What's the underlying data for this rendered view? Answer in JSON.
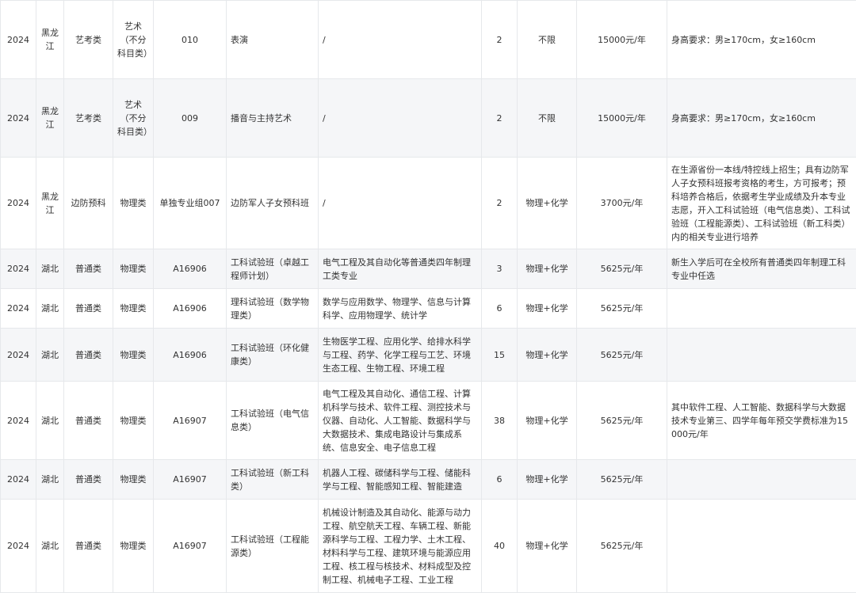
{
  "rows": [
    {
      "year": "2024",
      "province": "黑龙江",
      "type": "艺考类",
      "subject": "艺术（不分科目类）",
      "code": "010",
      "major": "表演",
      "includes": "/",
      "count": "2",
      "req": "不限",
      "fee": "15000元/年",
      "note": "身高要求：男≥170cm，女≥160cm"
    },
    {
      "year": "2024",
      "province": "黑龙江",
      "type": "艺考类",
      "subject": "艺术（不分科目类）",
      "code": "009",
      "major": "播音与主持艺术",
      "includes": "/",
      "count": "2",
      "req": "不限",
      "fee": "15000元/年",
      "note": "身高要求：男≥170cm，女≥160cm"
    },
    {
      "year": "2024",
      "province": "黑龙江",
      "type": "边防预科",
      "subject": "物理类",
      "code": "单独专业组007",
      "major": "边防军人子女预科班",
      "includes": "/",
      "count": "2",
      "req": "物理+化学",
      "fee": "3700元/年",
      "note": "在生源省份一本线/特控线上招生；具有边防军人子女预科班报考资格的考生，方可报考；预科培养合格后，依据考生学业成绩及升本专业志愿，开入工科试验班（电气信息类）、工科试验班（工程能源类）、工科试验班（新工科类）内的相关专业进行培养"
    },
    {
      "year": "2024",
      "province": "湖北",
      "type": "普通类",
      "subject": "物理类",
      "code": "A16906",
      "major": "工科试验班（卓越工程师计划）",
      "includes": "电气工程及其自动化等普通类四年制理工类专业",
      "count": "3",
      "req": "物理+化学",
      "fee": "5625元/年",
      "note": "新生入学后可在全校所有普通类四年制理工科专业中任选"
    },
    {
      "year": "2024",
      "province": "湖北",
      "type": "普通类",
      "subject": "物理类",
      "code": "A16906",
      "major": "理科试验班（数学物理类）",
      "includes": "数学与应用数学、物理学、信息与计算科学、应用物理学、统计学",
      "count": "6",
      "req": "物理+化学",
      "fee": "5625元/年",
      "note": ""
    },
    {
      "year": "2024",
      "province": "湖北",
      "type": "普通类",
      "subject": "物理类",
      "code": "A16906",
      "major": "工科试验班（环化健康类）",
      "includes": "生物医学工程、应用化学、给排水科学与工程、药学、化学工程与工艺、环境生态工程、生物工程、环境工程",
      "count": "15",
      "req": "物理+化学",
      "fee": "5625元/年",
      "note": ""
    },
    {
      "year": "2024",
      "province": "湖北",
      "type": "普通类",
      "subject": "物理类",
      "code": "A16907",
      "major": "工科试验班（电气信息类）",
      "includes": "电气工程及其自动化、通信工程、计算机科学与技术、软件工程、测控技术与仪器、自动化、人工智能、数据科学与大数据技术、集成电路设计与集成系统、信息安全、电子信息工程",
      "count": "38",
      "req": "物理+化学",
      "fee": "5625元/年",
      "note": "其中软件工程、人工智能、数据科学与大数据技术专业第三、四学年每年预交学费标准为15000元/年"
    },
    {
      "year": "2024",
      "province": "湖北",
      "type": "普通类",
      "subject": "物理类",
      "code": "A16907",
      "major": "工科试验班（新工科类）",
      "includes": "机器人工程、碳储科学与工程、储能科学与工程、智能感知工程、智能建造",
      "count": "6",
      "req": "物理+化学",
      "fee": "5625元/年",
      "note": ""
    },
    {
      "year": "2024",
      "province": "湖北",
      "type": "普通类",
      "subject": "物理类",
      "code": "A16907",
      "major": "工科试验班（工程能源类）",
      "includes": "机械设计制造及其自动化、能源与动力工程、航空航天工程、车辆工程、新能源科学与工程、工程力学、土木工程、材料科学与工程、建筑环境与能源应用工程、核工程与核技术、材料成型及控制工程、机械电子工程、工业工程",
      "count": "40",
      "req": "物理+化学",
      "fee": "5625元/年",
      "note": ""
    }
  ]
}
